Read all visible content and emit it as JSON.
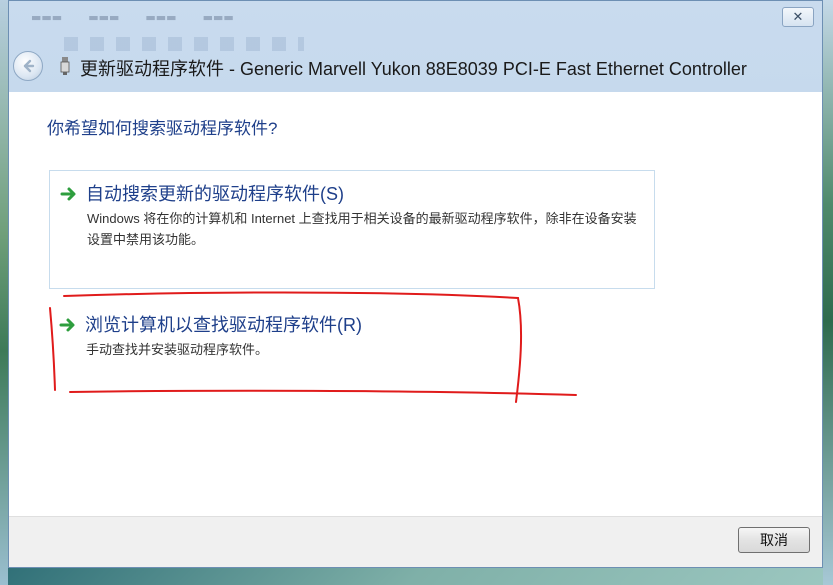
{
  "window": {
    "title": "更新驱动程序软件 - Generic Marvell Yukon 88E8039 PCI-E Fast Ethernet Controller",
    "close_symbol": "✕",
    "back_icon": "back-arrow-icon",
    "device_icon": "network-device-icon"
  },
  "main": {
    "question": "你希望如何搜索驱动程序软件?",
    "options": [
      {
        "title": "自动搜索更新的驱动程序软件(S)",
        "description": "Windows 将在你的计算机和 Internet 上查找用于相关设备的最新驱动程序软件，除非在设备安装设置中禁用该功能。",
        "icon": "green-arrow-icon"
      },
      {
        "title": "浏览计算机以查找驱动程序软件(R)",
        "description": "手动查找并安装驱动程序软件。",
        "icon": "green-arrow-icon"
      }
    ]
  },
  "footer": {
    "cancel_label": "取消"
  },
  "colors": {
    "heading_blue": "#1e3f8a",
    "arrow_green": "#2e9e3e",
    "annotation_red": "#e01b1b"
  }
}
